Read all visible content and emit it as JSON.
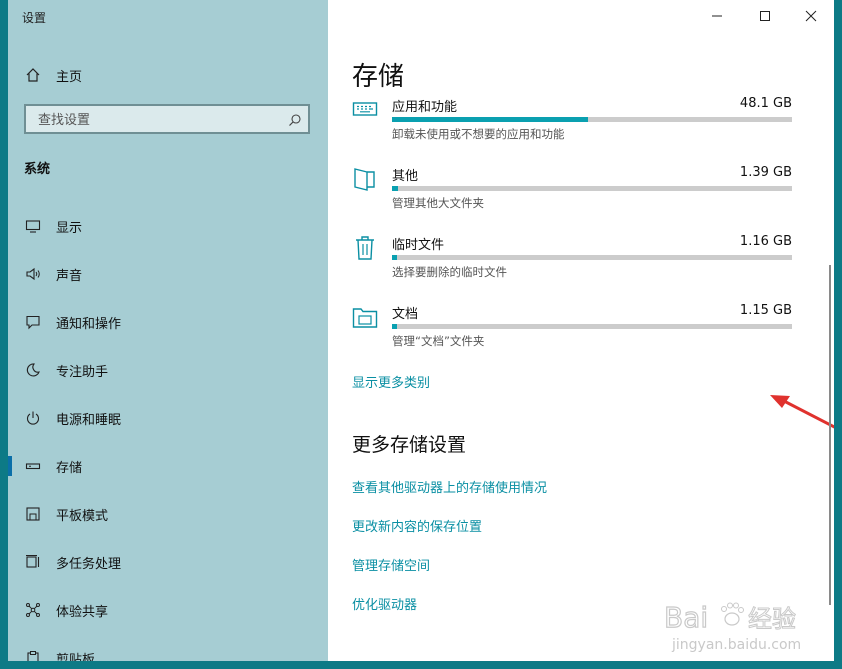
{
  "window": {
    "title": "设置"
  },
  "sidebar": {
    "home": "主页",
    "search": {
      "placeholder": "查找设置"
    },
    "section": "系统",
    "items": [
      {
        "label": "显示",
        "icon": "monitor-icon"
      },
      {
        "label": "声音",
        "icon": "speaker-icon"
      },
      {
        "label": "通知和操作",
        "icon": "notification-icon"
      },
      {
        "label": "专注助手",
        "icon": "moon-icon"
      },
      {
        "label": "电源和睡眠",
        "icon": "power-icon"
      },
      {
        "label": "存储",
        "icon": "storage-icon",
        "active": true
      },
      {
        "label": "平板模式",
        "icon": "tablet-icon"
      },
      {
        "label": "多任务处理",
        "icon": "multitask-icon"
      },
      {
        "label": "体验共享",
        "icon": "share-icon"
      },
      {
        "label": "剪贴板",
        "icon": "clipboard-icon"
      }
    ]
  },
  "main": {
    "title": "存储",
    "storage_items": [
      {
        "name": "应用和功能",
        "size": "48.1 GB",
        "desc": "卸载未使用或不想要的应用和功能",
        "fill": 0.49,
        "icon": "keyboard-icon"
      },
      {
        "name": "其他",
        "size": "1.39 GB",
        "desc": "管理其他大文件夹",
        "fill": 0.015,
        "icon": "folder-icon"
      },
      {
        "name": "临时文件",
        "size": "1.16 GB",
        "desc": "选择要删除的临时文件",
        "fill": 0.012,
        "icon": "trash-icon"
      },
      {
        "name": "文档",
        "size": "1.15 GB",
        "desc": "管理“文档”文件夹",
        "fill": 0.012,
        "icon": "documents-folder-icon"
      }
    ],
    "show_more": "显示更多类别",
    "more_settings_heading": "更多存储设置",
    "links": [
      "查看其他驱动器上的存储使用情况",
      "更改新内容的保存位置",
      "管理存储空间",
      "优化驱动器"
    ]
  },
  "watermark": {
    "brand": "Bai",
    "brand2": "经验",
    "url": "jingyan.baidu.com"
  },
  "colors": {
    "accent": "#0aa0b0",
    "sidebar_bg": "#a6cdd3",
    "link": "#0a8fa3",
    "arrow": "#e0322e"
  }
}
